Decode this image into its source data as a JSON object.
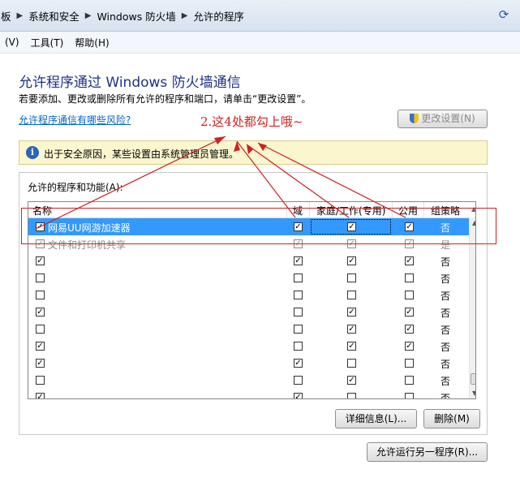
{
  "breadcrumb": {
    "items": [
      "板",
      "系统和安全",
      "Windows 防火墙",
      "允许的程序"
    ]
  },
  "menubar": {
    "items": [
      "(V)",
      "工具(T)",
      "帮助(H)"
    ]
  },
  "page": {
    "title": "允许程序通过 Windows 防火墙通信",
    "description": "若要添加、更改或删除所有允许的程序和端口，请单击“更改设置”。",
    "risk_link": "允许程序通信有哪些风险?",
    "change_settings_button": "更改设置(N)",
    "info_text": "出于安全原因，某些设置由系统管理员管理。",
    "group_label": "允许的程序和功能(A):"
  },
  "table": {
    "columns": [
      "名称",
      "域",
      "家庭/工作(专用)",
      "公用",
      "组策略"
    ],
    "rows": [
      {
        "name": "网易UU网游加速器",
        "enabled": true,
        "domain": true,
        "private": true,
        "public": true,
        "policy": "否",
        "selected": true,
        "greyed": false
      },
      {
        "name": "文件和打印机共享",
        "enabled": true,
        "domain": true,
        "private": true,
        "public": true,
        "policy": "是",
        "selected": false,
        "greyed": true
      },
      {
        "name": "",
        "enabled": true,
        "domain": true,
        "private": true,
        "public": true,
        "policy": "否",
        "selected": false,
        "greyed": false
      },
      {
        "name": "",
        "enabled": false,
        "domain": false,
        "private": false,
        "public": false,
        "policy": "否",
        "selected": false,
        "greyed": false
      },
      {
        "name": "",
        "enabled": false,
        "domain": false,
        "private": false,
        "public": false,
        "policy": "否",
        "selected": false,
        "greyed": false
      },
      {
        "name": "",
        "enabled": true,
        "domain": false,
        "private": true,
        "public": true,
        "policy": "否",
        "selected": false,
        "greyed": false
      },
      {
        "name": "",
        "enabled": false,
        "domain": false,
        "private": true,
        "public": true,
        "policy": "否",
        "selected": false,
        "greyed": false
      },
      {
        "name": "",
        "enabled": true,
        "domain": false,
        "private": true,
        "public": true,
        "policy": "否",
        "selected": false,
        "greyed": false
      },
      {
        "name": "",
        "enabled": true,
        "domain": true,
        "private": false,
        "public": false,
        "policy": "否",
        "selected": false,
        "greyed": false
      },
      {
        "name": "",
        "enabled": false,
        "domain": false,
        "private": true,
        "public": false,
        "policy": "否",
        "selected": false,
        "greyed": false
      },
      {
        "name": "",
        "enabled": true,
        "domain": true,
        "private": false,
        "public": false,
        "policy": "否",
        "selected": false,
        "greyed": false
      }
    ]
  },
  "buttons": {
    "details": "详细信息(L)...",
    "remove": "删除(M)",
    "allow_another": "允许运行另一程序(R)..."
  },
  "annotation": {
    "note": "2.这4处都勾上哦~",
    "color": "#d22222"
  }
}
